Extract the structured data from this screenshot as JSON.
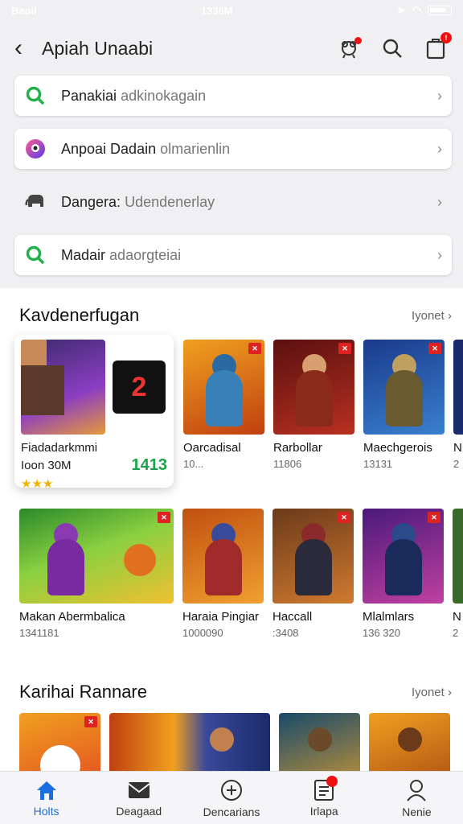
{
  "status": {
    "carrier": "Baoil",
    "time": "1336M"
  },
  "header": {
    "title": "Apiah Unaabi",
    "cart_badge": "!"
  },
  "rows": [
    {
      "label": "Panakiai",
      "sub": "adkinokagain",
      "style": "card",
      "icon": "search-icon",
      "color": "#22b04a"
    },
    {
      "label": "Anpoai Dadain",
      "sub": "olmarienlin",
      "style": "card",
      "icon": "app-logo-icon",
      "color": "#7a3cf0"
    },
    {
      "label": "Dangera:",
      "sub": "Udendenerlay",
      "style": "plain",
      "icon": "elephant-icon",
      "color": "#444"
    },
    {
      "label": "Madair",
      "sub": "adaorgteiai",
      "style": "card",
      "icon": "search-icon",
      "color": "#22b04a"
    }
  ],
  "section1": {
    "title": "Kavdenerfugan",
    "more": "Iyonet",
    "feature": {
      "name": "Fiadadarkmmi",
      "meta": "Ioon 30M",
      "score": "1413",
      "stars": "★★★"
    },
    "row1": [
      {
        "name": "Oarcadisal",
        "meta": "10..."
      },
      {
        "name": "Rarbollar",
        "meta": "11806"
      },
      {
        "name": "Maechgerois",
        "meta": "13131"
      },
      {
        "name": "N",
        "meta": "2"
      }
    ],
    "row2": [
      {
        "name": "Makan Abermbalica",
        "meta": "1341181"
      },
      {
        "name": "Haraia Pingiar",
        "meta": "1000090"
      },
      {
        "name": "Haccall",
        "meta": ":3408"
      },
      {
        "name": "Mlalmlars",
        "meta": "136 320"
      },
      {
        "name": "N",
        "meta": "2"
      }
    ]
  },
  "section2": {
    "title": "Karihai Rannare",
    "more": "Iyonet"
  },
  "tabs": [
    {
      "label": "Holts",
      "icon": "home-icon",
      "active": true
    },
    {
      "label": "Deagaad",
      "icon": "mail-icon",
      "active": false
    },
    {
      "label": "Dencarians",
      "icon": "plus-circle-icon",
      "active": false
    },
    {
      "label": "Irlapa",
      "icon": "list-icon",
      "active": false
    },
    {
      "label": "Nenie",
      "icon": "person-icon",
      "active": false
    }
  ],
  "colors": {
    "accent": "#1c6fe0",
    "badge": "#e11111",
    "green": "#1aa34a"
  }
}
